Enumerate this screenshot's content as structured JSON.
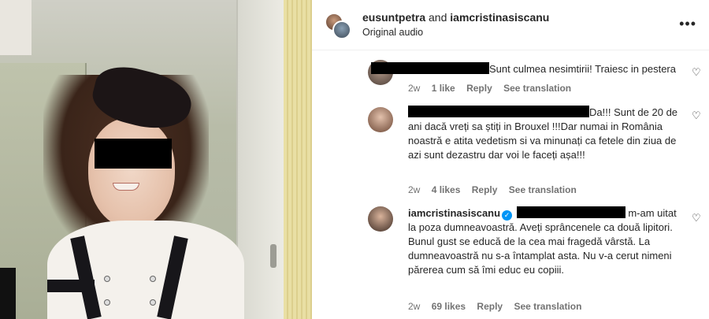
{
  "post": {
    "authors": {
      "first": "eusuntpetra",
      "connector": "and",
      "second": "iamcristinasiscanu"
    },
    "audio": "Original audio"
  },
  "comments": [
    {
      "text": "Sunt culmea nesimtirii! Traiesc in pestera",
      "time": "2w",
      "likes": "1 like",
      "reply": "Reply",
      "translate": "See translation"
    },
    {
      "text_first_line": "Da!!! Sunt de 20",
      "text_rest": "de ani dacă vreți sa știți in Brouxel !!!Dar numai in România noastră e atita vedetism si va minunați ca fetele din ziua de azi sunt dezastru dar voi le faceți așa!!!",
      "time": "2w",
      "likes": "4 likes",
      "reply": "Reply",
      "translate": "See translation"
    },
    {
      "username": "iamcristinasiscanu",
      "text_first_line": "m-am",
      "text_rest": "uitat la poza dumneavoastră. Aveți sprâncenele ca două lipitori. Bunul gust se educă de la cea mai fragedă vârstă. La dumneavoastră nu s-a întamplat asta. Nu v-a cerut nimeni părerea cum să îmi educ eu copiii.",
      "time": "2w",
      "likes": "69 likes",
      "reply": "Reply",
      "translate": "See translation"
    }
  ],
  "icons": {
    "more": "more-options-icon",
    "heart": "heart-outline-icon",
    "verified": "verified-badge-icon"
  },
  "colors": {
    "text": "#262626",
    "meta": "#737373",
    "verified": "#0095f6"
  }
}
